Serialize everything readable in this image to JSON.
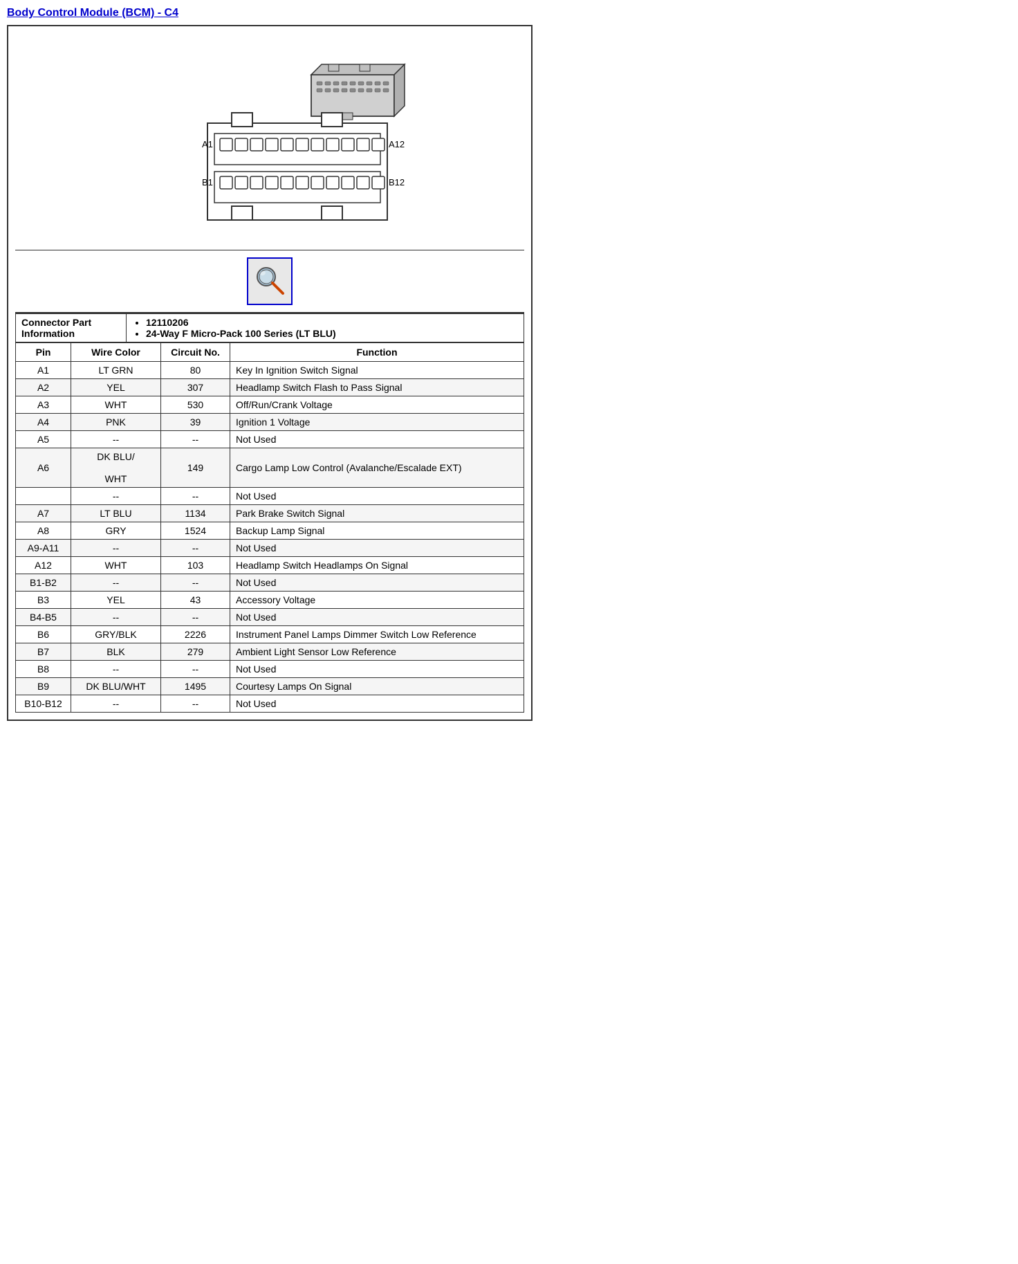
{
  "title": "Body Control Module (BCM) - C4",
  "connector_info": {
    "label": "Connector Part Information",
    "details": [
      "12110206",
      "24-Way F Micro-Pack 100 Series (LT BLU)"
    ]
  },
  "table_headers": {
    "pin": "Pin",
    "wire_color": "Wire Color",
    "circuit_no": "Circuit No.",
    "function": "Function"
  },
  "pins": [
    {
      "pin": "A1",
      "wire_color": "LT GRN",
      "circuit_no": "80",
      "function": "Key In Ignition Switch Signal"
    },
    {
      "pin": "A2",
      "wire_color": "YEL",
      "circuit_no": "307",
      "function": "Headlamp Switch Flash to Pass Signal"
    },
    {
      "pin": "A3",
      "wire_color": "WHT",
      "circuit_no": "530",
      "function": "Off/Run/Crank Voltage"
    },
    {
      "pin": "A4",
      "wire_color": "PNK",
      "circuit_no": "39",
      "function": "Ignition 1 Voltage"
    },
    {
      "pin": "A5",
      "wire_color": "--",
      "circuit_no": "--",
      "function": "Not Used"
    },
    {
      "pin": "A6",
      "wire_color": "DK BLU/\n\nWHT",
      "circuit_no": "149",
      "function": "Cargo Lamp Low Control (Avalanche/Escalade EXT)"
    },
    {
      "pin": "",
      "wire_color": "--",
      "circuit_no": "--",
      "function": "Not Used"
    },
    {
      "pin": "A7",
      "wire_color": "LT BLU",
      "circuit_no": "1134",
      "function": "Park Brake Switch Signal"
    },
    {
      "pin": "A8",
      "wire_color": "GRY",
      "circuit_no": "1524",
      "function": "Backup Lamp Signal"
    },
    {
      "pin": "A9-A11",
      "wire_color": "--",
      "circuit_no": "--",
      "function": "Not Used"
    },
    {
      "pin": "A12",
      "wire_color": "WHT",
      "circuit_no": "103",
      "function": "Headlamp Switch Headlamps On Signal"
    },
    {
      "pin": "B1-B2",
      "wire_color": "--",
      "circuit_no": "--",
      "function": "Not Used"
    },
    {
      "pin": "B3",
      "wire_color": "YEL",
      "circuit_no": "43",
      "function": "Accessory Voltage"
    },
    {
      "pin": "B4-B5",
      "wire_color": "--",
      "circuit_no": "--",
      "function": "Not Used"
    },
    {
      "pin": "B6",
      "wire_color": "GRY/BLK",
      "circuit_no": "2226",
      "function": "Instrument Panel Lamps Dimmer Switch Low Reference"
    },
    {
      "pin": "B7",
      "wire_color": "BLK",
      "circuit_no": "279",
      "function": "Ambient Light Sensor Low Reference"
    },
    {
      "pin": "B8",
      "wire_color": "--",
      "circuit_no": "--",
      "function": "Not Used"
    },
    {
      "pin": "B9",
      "wire_color": "DK BLU/WHT",
      "circuit_no": "1495",
      "function": "Courtesy Lamps On Signal"
    },
    {
      "pin": "B10-B12",
      "wire_color": "--",
      "circuit_no": "--",
      "function": "Not Used"
    }
  ]
}
